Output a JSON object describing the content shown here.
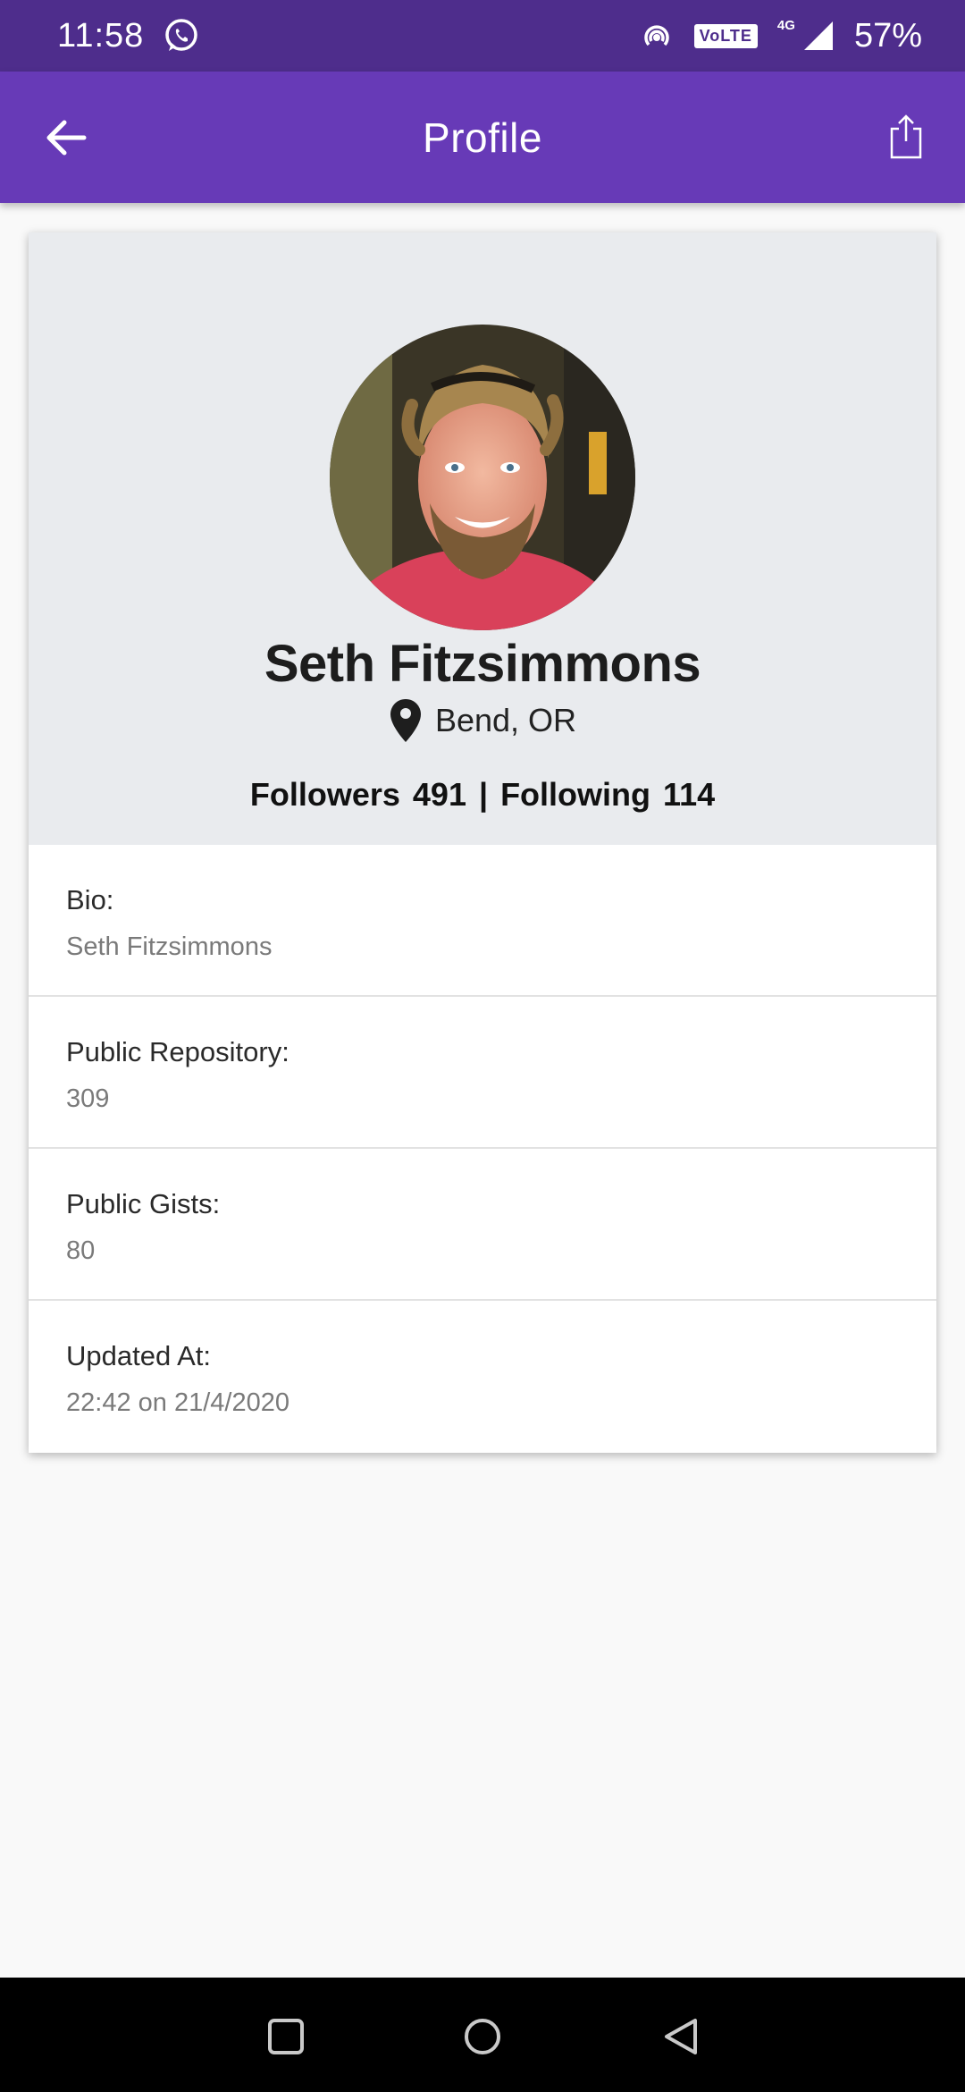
{
  "status_bar": {
    "time": "11:58",
    "network_label": "4G",
    "volte_label": "VoLTE",
    "battery": "57%",
    "icons": [
      "whatsapp-icon",
      "hotspot-icon",
      "signal-icon"
    ]
  },
  "app_bar": {
    "title": "Profile",
    "back_icon": "arrow-left-icon",
    "share_icon": "share-icon"
  },
  "profile": {
    "name": "Seth Fitzsimmons",
    "location": "Bend, OR",
    "followers_label": "Followers",
    "followers_count": "491",
    "separator": "|",
    "following_label": "Following",
    "following_count": "114"
  },
  "details": [
    {
      "label": "Bio:",
      "value": "Seth Fitzsimmons"
    },
    {
      "label": "Public Repository:",
      "value": "309"
    },
    {
      "label": "Public Gists:",
      "value": "80"
    },
    {
      "label": "Updated At:",
      "value": "22:42 on 21/4/2020"
    }
  ],
  "colors": {
    "status_bar": "#4e2d8c",
    "app_bar": "#673ab7",
    "header_bg": "#e9ebee"
  },
  "nav_bar": {
    "icons": [
      "recents-square-icon",
      "home-circle-icon",
      "back-triangle-icon"
    ]
  }
}
